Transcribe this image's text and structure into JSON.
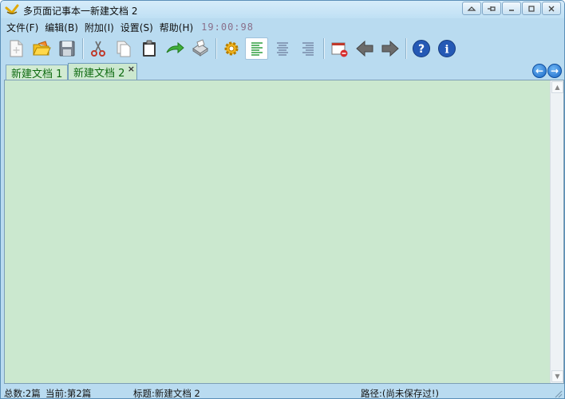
{
  "window": {
    "title": "多页面记事本一新建文档 2"
  },
  "menu": {
    "items": [
      "文件(F)",
      "编辑(B)",
      "附加(I)",
      "设置(S)",
      "帮助(H)"
    ],
    "clock": "19:00:98"
  },
  "toolbar": {
    "buttons": [
      {
        "name": "new-file",
        "icon": "new-file-icon"
      },
      {
        "name": "open-file",
        "icon": "open-folder-icon"
      },
      {
        "name": "save",
        "icon": "floppy-disk-icon"
      },
      {
        "name": "cut",
        "icon": "scissors-icon"
      },
      {
        "name": "copy",
        "icon": "copy-pages-icon"
      },
      {
        "name": "paste",
        "icon": "clipboard-icon"
      },
      {
        "name": "redo",
        "icon": "green-arrow-icon"
      },
      {
        "name": "print",
        "icon": "printer-icon"
      },
      {
        "name": "settings",
        "icon": "gear-icon"
      },
      {
        "name": "align-left",
        "icon": "align-left-icon"
      },
      {
        "name": "align-center",
        "icon": "align-center-icon"
      },
      {
        "name": "align-right",
        "icon": "align-right-icon"
      },
      {
        "name": "close-doc",
        "icon": "close-document-icon"
      },
      {
        "name": "back",
        "icon": "arrow-left-icon"
      },
      {
        "name": "forward",
        "icon": "arrow-right-icon"
      },
      {
        "name": "help",
        "icon": "help-icon"
      },
      {
        "name": "about",
        "icon": "info-icon"
      }
    ]
  },
  "tabs": [
    {
      "label": "新建文档 1",
      "active": false
    },
    {
      "label": "新建文档 2",
      "active": true
    }
  ],
  "tab_close": "×",
  "editor": {
    "content": "",
    "background": "#cbe8cf"
  },
  "status": {
    "total": "总数:2篇",
    "current": "当前:第2篇",
    "title": "标题:新建文档 2",
    "path": "路径:(尚未保存过!)"
  },
  "colors": {
    "frame": "#b9dbf0",
    "tab_text": "#0e6a10",
    "clock": "#8a6f8a"
  }
}
